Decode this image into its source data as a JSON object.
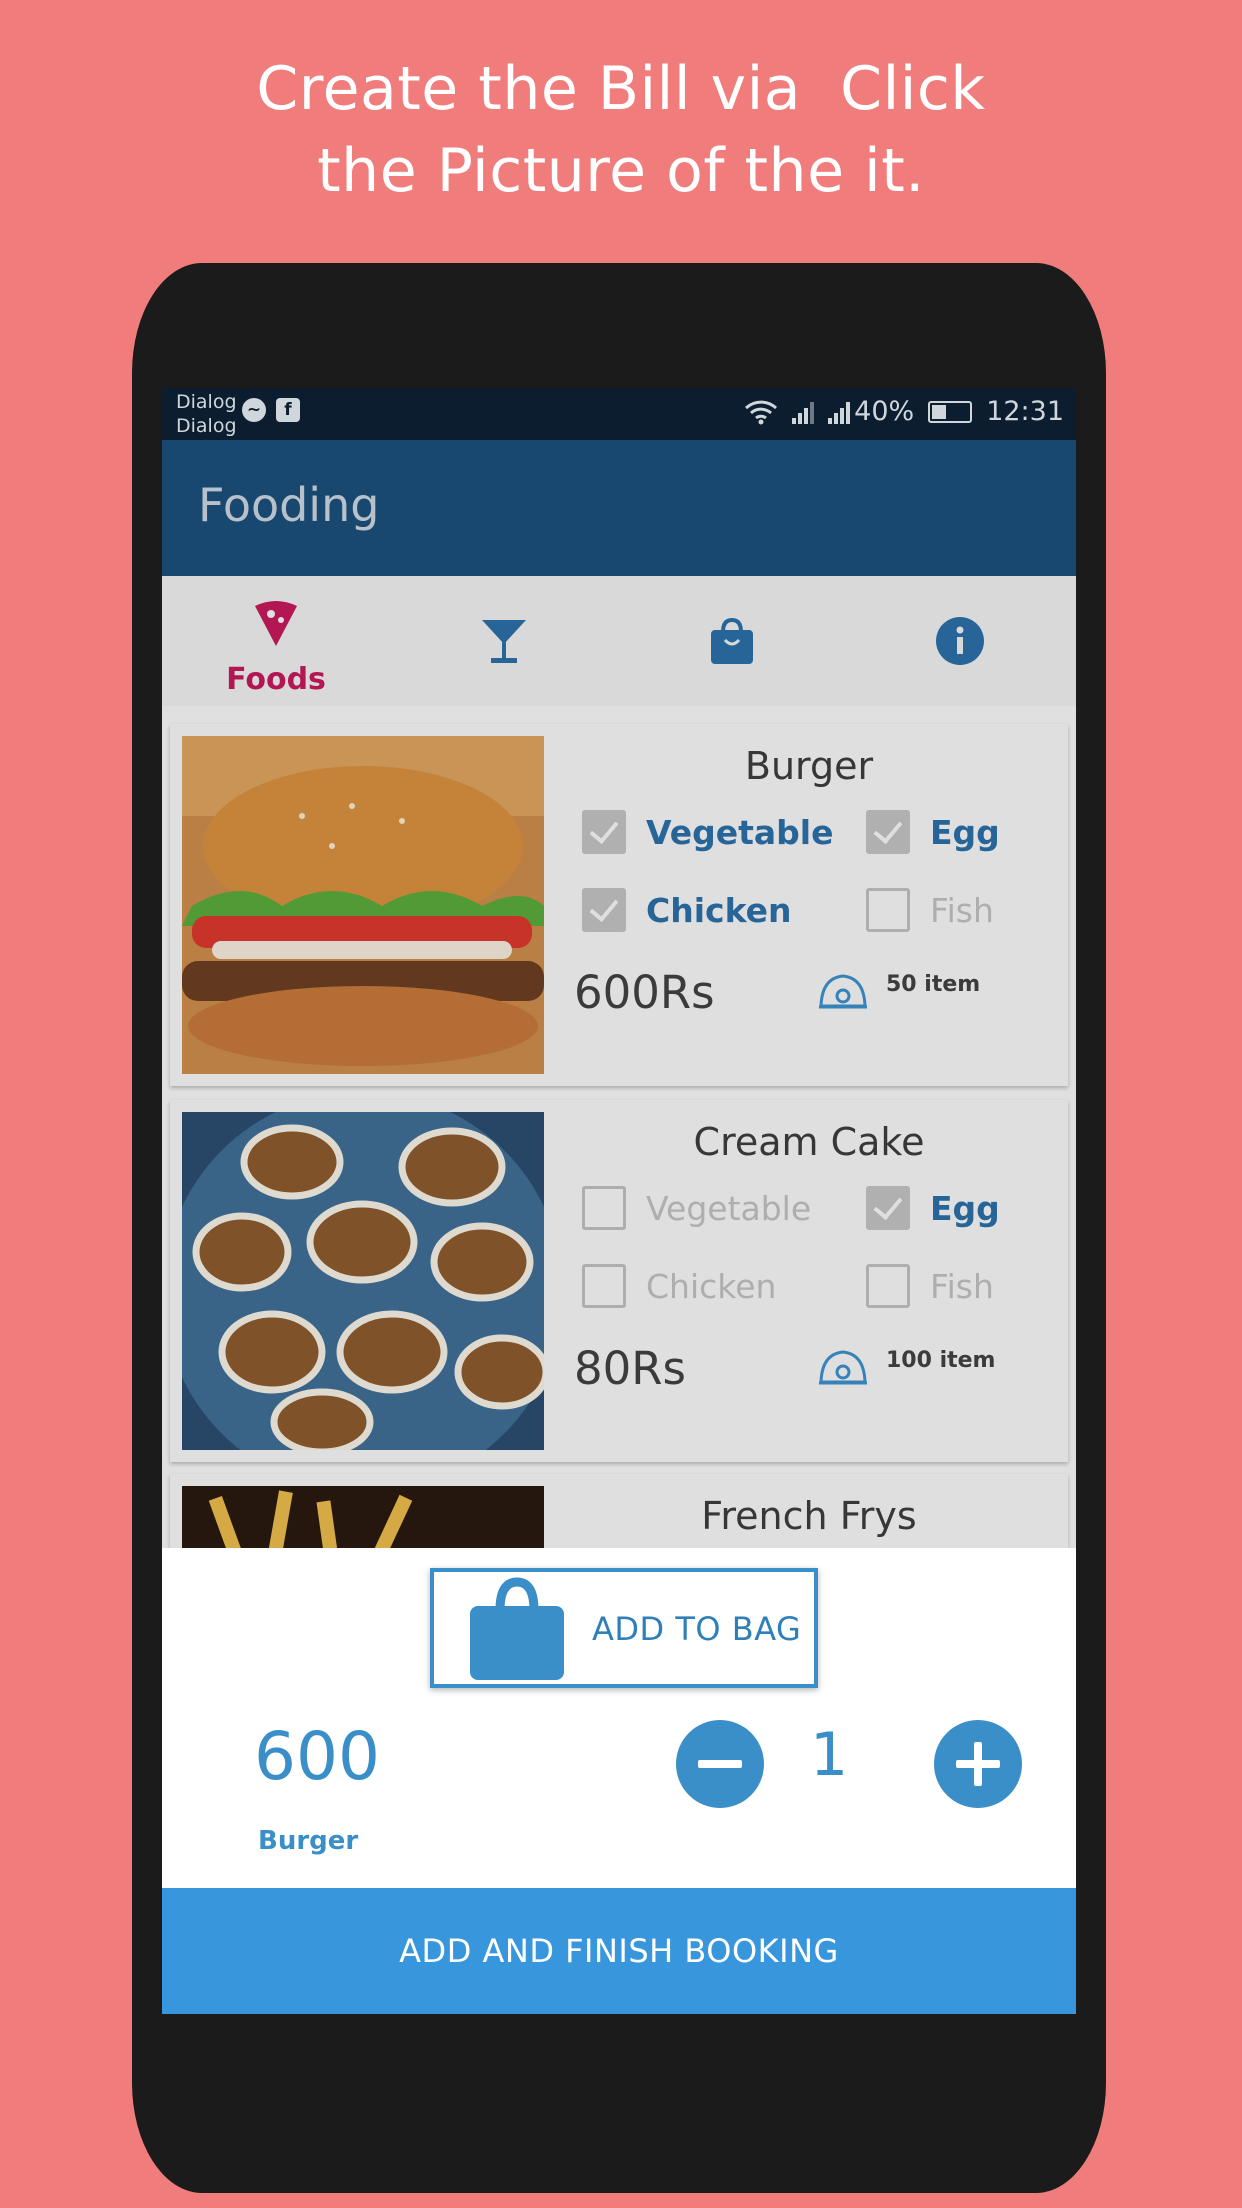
{
  "headline": {
    "line1": "Create the Bill via  Click",
    "line2": "the Picture of the it."
  },
  "status_bar": {
    "carrier1": "Dialog",
    "carrier2": "Dialog",
    "battery": "40%",
    "battery_level": 0.4,
    "time": "12:31"
  },
  "app": {
    "title": "Fooding"
  },
  "tabs": [
    {
      "label": "Foods",
      "icon": "pizza-icon",
      "active": true
    },
    {
      "label": "",
      "icon": "cocktail-icon"
    },
    {
      "label": "",
      "icon": "bag-icon"
    },
    {
      "label": "",
      "icon": "info-icon"
    }
  ],
  "items": [
    {
      "name": "Burger",
      "options": [
        {
          "label": "Vegetable",
          "checked": true
        },
        {
          "label": "Egg",
          "checked": true
        },
        {
          "label": "Chicken",
          "checked": true
        },
        {
          "label": "Fish",
          "checked": false
        }
      ],
      "price": "600Rs",
      "stock": "50 item"
    },
    {
      "name": "Cream Cake",
      "options": [
        {
          "label": "Vegetable",
          "checked": false
        },
        {
          "label": "Egg",
          "checked": true
        },
        {
          "label": "Chicken",
          "checked": false
        },
        {
          "label": "Fish",
          "checked": false
        }
      ],
      "price": "80Rs",
      "stock": "100 item"
    },
    {
      "name": "French Frys"
    }
  ],
  "sheet": {
    "add_to_bag": "ADD TO BAG",
    "total": "600",
    "item_name": "Burger",
    "quantity": "1",
    "finish": "ADD AND FINISH BOOKING"
  },
  "colors": {
    "background": "#f07d7b",
    "app_bar": "#1b4f79",
    "accent": "#3a8fc9",
    "tab_active": "#c2185b",
    "finish_button": "#3897dc"
  }
}
